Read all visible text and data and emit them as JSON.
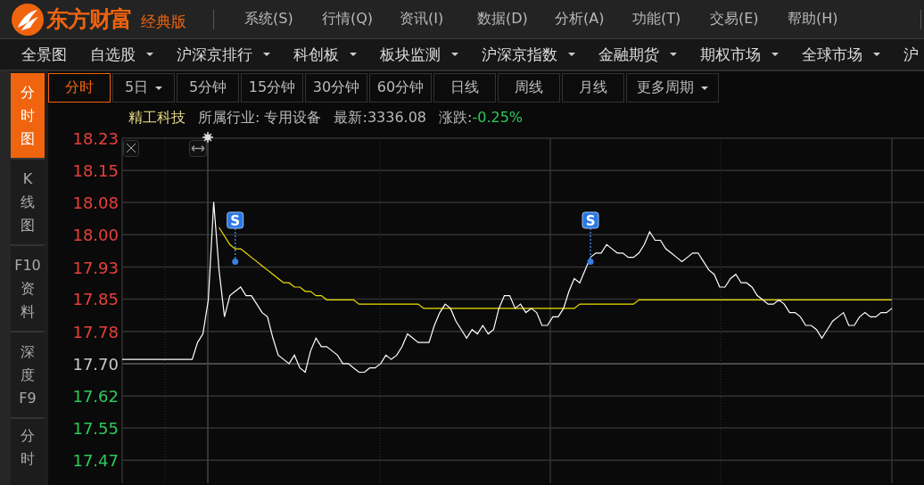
{
  "app": {
    "brand": "东方财富",
    "edition": "经典版"
  },
  "menu": [
    {
      "label": "系统(S)"
    },
    {
      "label": "行情(Q)"
    },
    {
      "label": "资讯(I)"
    },
    {
      "label": "数据(D)"
    },
    {
      "label": "分析(A)"
    },
    {
      "label": "功能(T)"
    },
    {
      "label": "交易(E)"
    },
    {
      "label": "帮助(H)"
    }
  ],
  "nav": [
    {
      "label": "全景图",
      "dropdown": false
    },
    {
      "label": "自选股",
      "dropdown": true
    },
    {
      "label": "沪深京排行",
      "dropdown": true
    },
    {
      "label": "科创板",
      "dropdown": true
    },
    {
      "label": "板块监测",
      "dropdown": true
    },
    {
      "label": "沪深京指数",
      "dropdown": true
    },
    {
      "label": "金融期货",
      "dropdown": true
    },
    {
      "label": "期权市场",
      "dropdown": true
    },
    {
      "label": "全球市场",
      "dropdown": true
    },
    {
      "label": "沪",
      "dropdown": false
    }
  ],
  "sidebar": [
    {
      "label": "分时图",
      "selected": true
    },
    {
      "label": "K线图",
      "selected": false
    },
    {
      "label": "F10资料",
      "selected": false
    },
    {
      "label": "深度F9",
      "selected": false
    },
    {
      "label": "分时",
      "selected": false
    }
  ],
  "periods": [
    {
      "label": "分时",
      "selected": true,
      "dropdown": false
    },
    {
      "label": "5日",
      "selected": false,
      "dropdown": true
    },
    {
      "label": "5分钟",
      "selected": false,
      "dropdown": false
    },
    {
      "label": "15分钟",
      "selected": false,
      "dropdown": false
    },
    {
      "label": "30分钟",
      "selected": false,
      "dropdown": false
    },
    {
      "label": "60分钟",
      "selected": false,
      "dropdown": false
    },
    {
      "label": "日线",
      "selected": false,
      "dropdown": false
    },
    {
      "label": "周线",
      "selected": false,
      "dropdown": false
    },
    {
      "label": "月线",
      "selected": false,
      "dropdown": false
    },
    {
      "label": "更多周期",
      "selected": false,
      "dropdown": true
    }
  ],
  "info": {
    "name": "精工科技",
    "industry": "所属行业: 专用设备",
    "latest": "最新:3336.08",
    "change_label": "涨跌:",
    "change_value": "-0.25%"
  },
  "chart": {
    "chart_data": {
      "type": "line",
      "ylim": [
        17.419,
        18.23
      ],
      "grid": true,
      "ref_lines": [
        {
          "axis": "y",
          "value": 17.7
        }
      ],
      "yticks": [
        {
          "value": 18.23,
          "label": "18.23"
        },
        {
          "value": 18.154,
          "label": "18.15"
        },
        {
          "value": 18.079,
          "label": "18.08"
        },
        {
          "value": 18.003,
          "label": "18.00"
        },
        {
          "value": 17.927,
          "label": "17.93"
        },
        {
          "value": 17.852,
          "label": "17.85"
        },
        {
          "value": 17.776,
          "label": "17.78"
        },
        {
          "value": 17.7,
          "label": "17.70"
        },
        {
          "value": 17.624,
          "label": "17.62"
        },
        {
          "value": 17.549,
          "label": "17.55"
        },
        {
          "value": 17.473,
          "label": "17.47"
        }
      ],
      "series": [
        {
          "color": "#ffffff",
          "values": [
            17.71,
            17.71,
            17.71,
            17.71,
            17.71,
            17.71,
            17.71,
            17.71,
            17.71,
            17.71,
            17.71,
            17.71,
            17.71,
            17.71,
            17.75,
            17.77,
            17.85,
            18.08,
            17.92,
            17.81,
            17.86,
            17.87,
            17.88,
            17.86,
            17.86,
            17.84,
            17.82,
            17.81,
            17.76,
            17.72,
            17.71,
            17.7,
            17.72,
            17.69,
            17.68,
            17.73,
            17.76,
            17.74,
            17.74,
            17.73,
            17.72,
            17.7,
            17.7,
            17.69,
            17.68,
            17.68,
            17.69,
            17.69,
            17.7,
            17.72,
            17.71,
            17.72,
            17.74,
            17.77,
            17.76,
            17.75,
            17.75,
            17.75,
            17.79,
            17.82,
            17.84,
            17.83,
            17.8,
            17.78,
            17.76,
            17.78,
            17.77,
            17.79,
            17.77,
            17.78,
            17.83,
            17.86,
            17.86,
            17.83,
            17.84,
            17.82,
            17.83,
            17.82,
            17.79,
            17.79,
            17.81,
            17.81,
            17.83,
            17.87,
            17.9,
            17.89,
            17.92,
            17.95,
            17.96,
            17.96,
            17.98,
            17.97,
            17.96,
            17.96,
            17.95,
            17.95,
            17.96,
            17.98,
            18.01,
            17.99,
            17.99,
            17.97,
            17.96,
            17.95,
            17.94,
            17.95,
            17.96,
            17.96,
            17.94,
            17.92,
            17.91,
            17.88,
            17.88,
            17.9,
            17.91,
            17.89,
            17.89,
            17.88,
            17.86,
            17.85,
            17.84,
            17.84,
            17.85,
            17.84,
            17.82,
            17.82,
            17.81,
            17.79,
            17.79,
            17.78,
            17.76,
            17.78,
            17.8,
            17.81,
            17.82,
            17.79,
            17.79,
            17.81,
            17.82,
            17.81,
            17.81,
            17.82,
            17.82,
            17.83
          ]
        },
        {
          "color": "#f0e000",
          "values": [
            null,
            null,
            null,
            null,
            null,
            null,
            null,
            null,
            null,
            null,
            null,
            null,
            null,
            null,
            null,
            null,
            null,
            null,
            18.02,
            18.0,
            17.98,
            17.97,
            17.97,
            17.96,
            17.95,
            17.94,
            17.93,
            17.92,
            17.91,
            17.9,
            17.89,
            17.89,
            17.88,
            17.88,
            17.87,
            17.87,
            17.86,
            17.86,
            17.85,
            17.85,
            17.85,
            17.85,
            17.85,
            17.85,
            17.84,
            17.84,
            17.84,
            17.84,
            17.84,
            17.84,
            17.84,
            17.84,
            17.84,
            17.84,
            17.84,
            17.84,
            17.83,
            17.83,
            17.83,
            17.83,
            17.83,
            17.83,
            17.83,
            17.83,
            17.83,
            17.83,
            17.83,
            17.83,
            17.83,
            17.83,
            17.83,
            17.83,
            17.83,
            17.83,
            17.83,
            17.83,
            17.83,
            17.83,
            17.83,
            17.83,
            17.83,
            17.83,
            17.83,
            17.83,
            17.83,
            17.84,
            17.84,
            17.84,
            17.84,
            17.84,
            17.84,
            17.84,
            17.84,
            17.84,
            17.84,
            17.84,
            17.85,
            17.85,
            17.85,
            17.85,
            17.85,
            17.85,
            17.85,
            17.85,
            17.85,
            17.85,
            17.85,
            17.85,
            17.85,
            17.85,
            17.85,
            17.85,
            17.85,
            17.85,
            17.85,
            17.85,
            17.85,
            17.85,
            17.85,
            17.85,
            17.85,
            17.85,
            17.85,
            17.85,
            17.85,
            17.85,
            17.85,
            17.85,
            17.85,
            17.85,
            17.85,
            17.85,
            17.85,
            17.85,
            17.85,
            17.85,
            17.85,
            17.85,
            17.85,
            17.85,
            17.85,
            17.85,
            17.85,
            17.85
          ]
        }
      ],
      "annotations": [
        {
          "y": 17.94,
          "text": "S"
        },
        {
          "y": 17.94,
          "text": "S"
        }
      ]
    }
  }
}
